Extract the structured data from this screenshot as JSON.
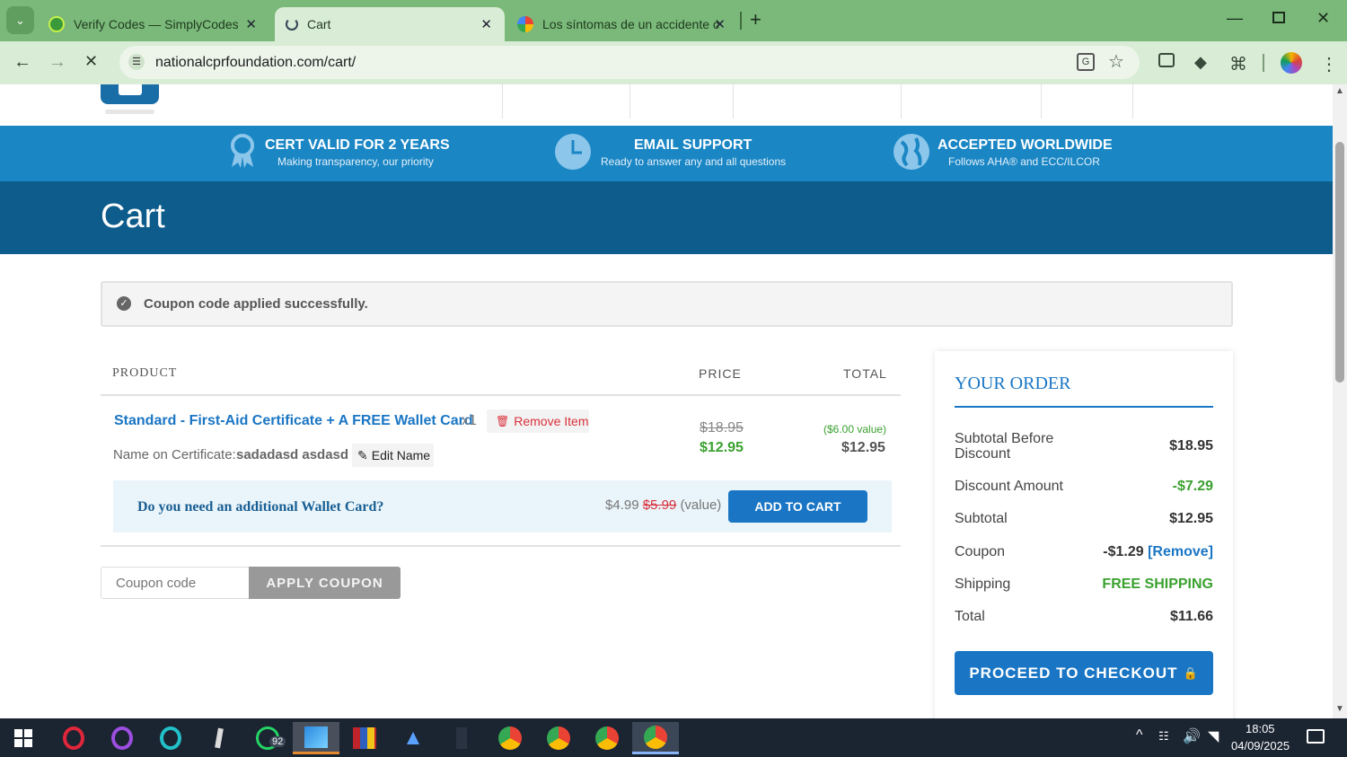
{
  "browser": {
    "tabs": [
      {
        "title": "Verify Codes — SimplyCodes",
        "active": false
      },
      {
        "title": "Cart",
        "active": true
      },
      {
        "title": "Los síntomas de un accidente c",
        "active": false
      }
    ],
    "url": "nationalcprfoundation.com/cart/"
  },
  "features": [
    {
      "title": "CERT VALID FOR 2 YEARS",
      "subtitle": "Making transparency, our priority",
      "icon": "ribbon-icon"
    },
    {
      "title": "EMAIL SUPPORT",
      "subtitle": "Ready to answer any and all questions",
      "icon": "clock-icon"
    },
    {
      "title": "ACCEPTED WORLDWIDE",
      "subtitle": "Follows AHA® and ECC/ILCOR",
      "icon": "globe-icon"
    }
  ],
  "page_title": "Cart",
  "notice": "Coupon code applied successfully.",
  "cart_table": {
    "headers": {
      "product": "PRODUCT",
      "price": "PRICE",
      "total": "TOTAL"
    },
    "item": {
      "name": "Standard - First-Aid Certificate + A FREE Wallet Card",
      "qty": "x1",
      "remove_label": "Remove Item",
      "name_label": "Name on Certificate:",
      "name_value": "sadadasd asdasd",
      "edit_label": "Edit Name",
      "price_old": "$18.95",
      "price_new": "$12.95",
      "value_note": "($6.00 value)",
      "total": "$12.95"
    },
    "upsell": {
      "question": "Do you need an additional Wallet Card?",
      "price": "$4.99",
      "price_old": "$5.99",
      "value_label": "(value)",
      "button": "ADD TO CART"
    }
  },
  "coupon": {
    "placeholder": "Coupon code",
    "button": "APPLY COUPON"
  },
  "order": {
    "title": "YOUR ORDER",
    "rows": [
      {
        "label": "Subtotal Before Discount",
        "value": "$18.95"
      },
      {
        "label": "Discount Amount",
        "value": "-$7.29"
      },
      {
        "label": "Subtotal",
        "value": "$12.95"
      },
      {
        "label": "Coupon",
        "value": "-$1.29",
        "link": "[Remove]"
      },
      {
        "label": "Shipping",
        "value": "FREE SHIPPING"
      },
      {
        "label": "Total",
        "value": "$11.66"
      }
    ],
    "checkout": "PROCEED TO CHECKOUT"
  },
  "taskbar": {
    "whatsapp_badge": "92",
    "time": "18:05",
    "date": "04/09/2025"
  },
  "colors": {
    "tab_strip": "#7ab979",
    "toolbar": "#d9ecd6",
    "feature_bar": "#1a86c4",
    "cart_banner": "#0d5c8c",
    "link_blue": "#1a76c4",
    "green_price": "#3aa12f",
    "red": "#d9303a"
  }
}
